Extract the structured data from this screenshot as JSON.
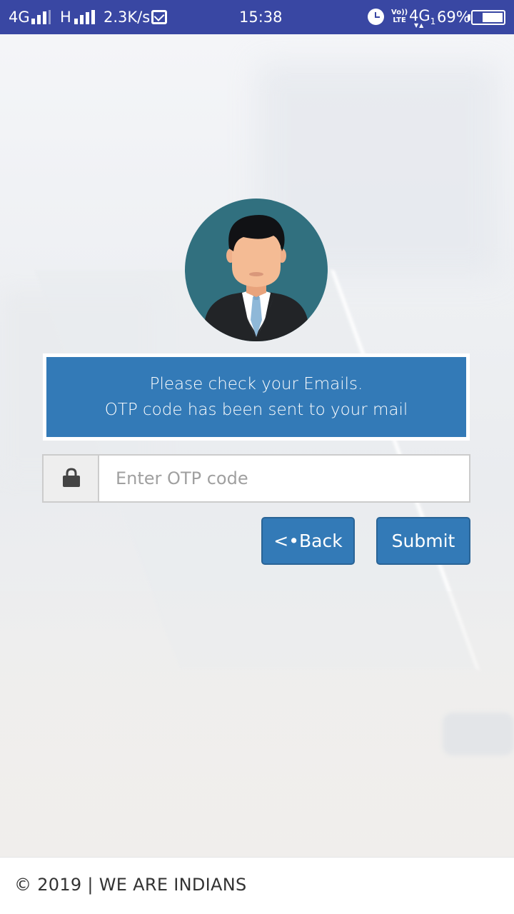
{
  "status_bar": {
    "network1": "4G",
    "network2": "H",
    "speed": "2.3K/s",
    "time": "15:38",
    "volte_top": "Vo))",
    "volte_bottom": "LTE",
    "network3": "4G",
    "network3_sub": "1",
    "battery": "69%",
    "icons": [
      "signal-icon",
      "mail-notification-icon",
      "alarm-icon",
      "battery-icon"
    ]
  },
  "avatar": {
    "icon": "user-avatar-icon"
  },
  "alert": {
    "line1": "Please check your Emails.",
    "line2": "OTP code has been sent to your mail"
  },
  "otp": {
    "placeholder": "Enter OTP code",
    "value": "",
    "icon": "lock-icon"
  },
  "buttons": {
    "back": "<•Back",
    "submit": "Submit"
  },
  "footer": {
    "text": "© 2019 | WE ARE INDIANS"
  },
  "colors": {
    "status_bar": "#3947a3",
    "primary": "#337ab7",
    "avatar_bg": "#31707f"
  }
}
